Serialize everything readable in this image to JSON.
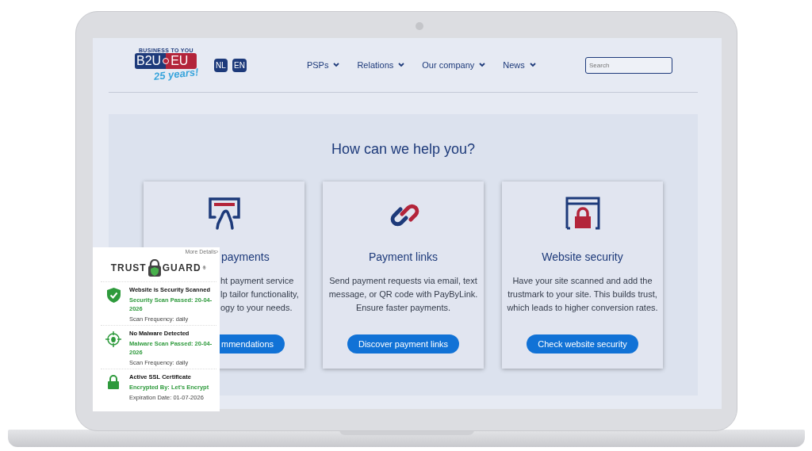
{
  "logo": {
    "tagline": "BUSINESS TO YOU",
    "left": "B2U",
    "right": "EU",
    "badge": "25 years!"
  },
  "languages": [
    {
      "label": "NL"
    },
    {
      "label": "EN"
    }
  ],
  "nav": [
    {
      "label": "PSPs"
    },
    {
      "label": "Relations"
    },
    {
      "label": "Our company"
    },
    {
      "label": "News"
    }
  ],
  "search": {
    "placeholder": "Search"
  },
  "heading": "How can we help you?",
  "cards": [
    {
      "kind": "card",
      "title": "payments",
      "lines": [
        "ht payment service",
        "lp tailor functionality,",
        "ogy to your needs."
      ],
      "button": "mmendations"
    },
    {
      "kind": "link",
      "title": "Payment links",
      "lines": [
        "Send payment requests via email, text",
        "message, or QR code with PayByLink.",
        "Ensure faster payments."
      ],
      "button": "Discover payment links"
    },
    {
      "kind": "security",
      "title": "Website security",
      "lines": [
        "Have your site scanned and add the",
        "trustmark to your site. This builds trust,",
        "which leads to higher conversion rates."
      ],
      "button": "Check website security"
    }
  ],
  "trust_guard": {
    "more": "More Details›",
    "brand_left": "TRUST",
    "brand_right": "GUARD",
    "brand_mark": "®",
    "items": [
      {
        "kind": "shield",
        "title": "Website is Security Scanned",
        "status": "Security Scan Passed: 20-04-2026",
        "detail": "Scan Frequency: daily"
      },
      {
        "kind": "bug",
        "title": "No Malware Detected",
        "status": "Malware Scan Passed: 20-04-2026",
        "detail": "Scan Frequency: daily"
      },
      {
        "kind": "lock",
        "title": "Active SSL Certificate",
        "status": "Encrypted By: Let's Encrypt",
        "detail": "Expiration Date: 01-07-2026"
      }
    ]
  }
}
